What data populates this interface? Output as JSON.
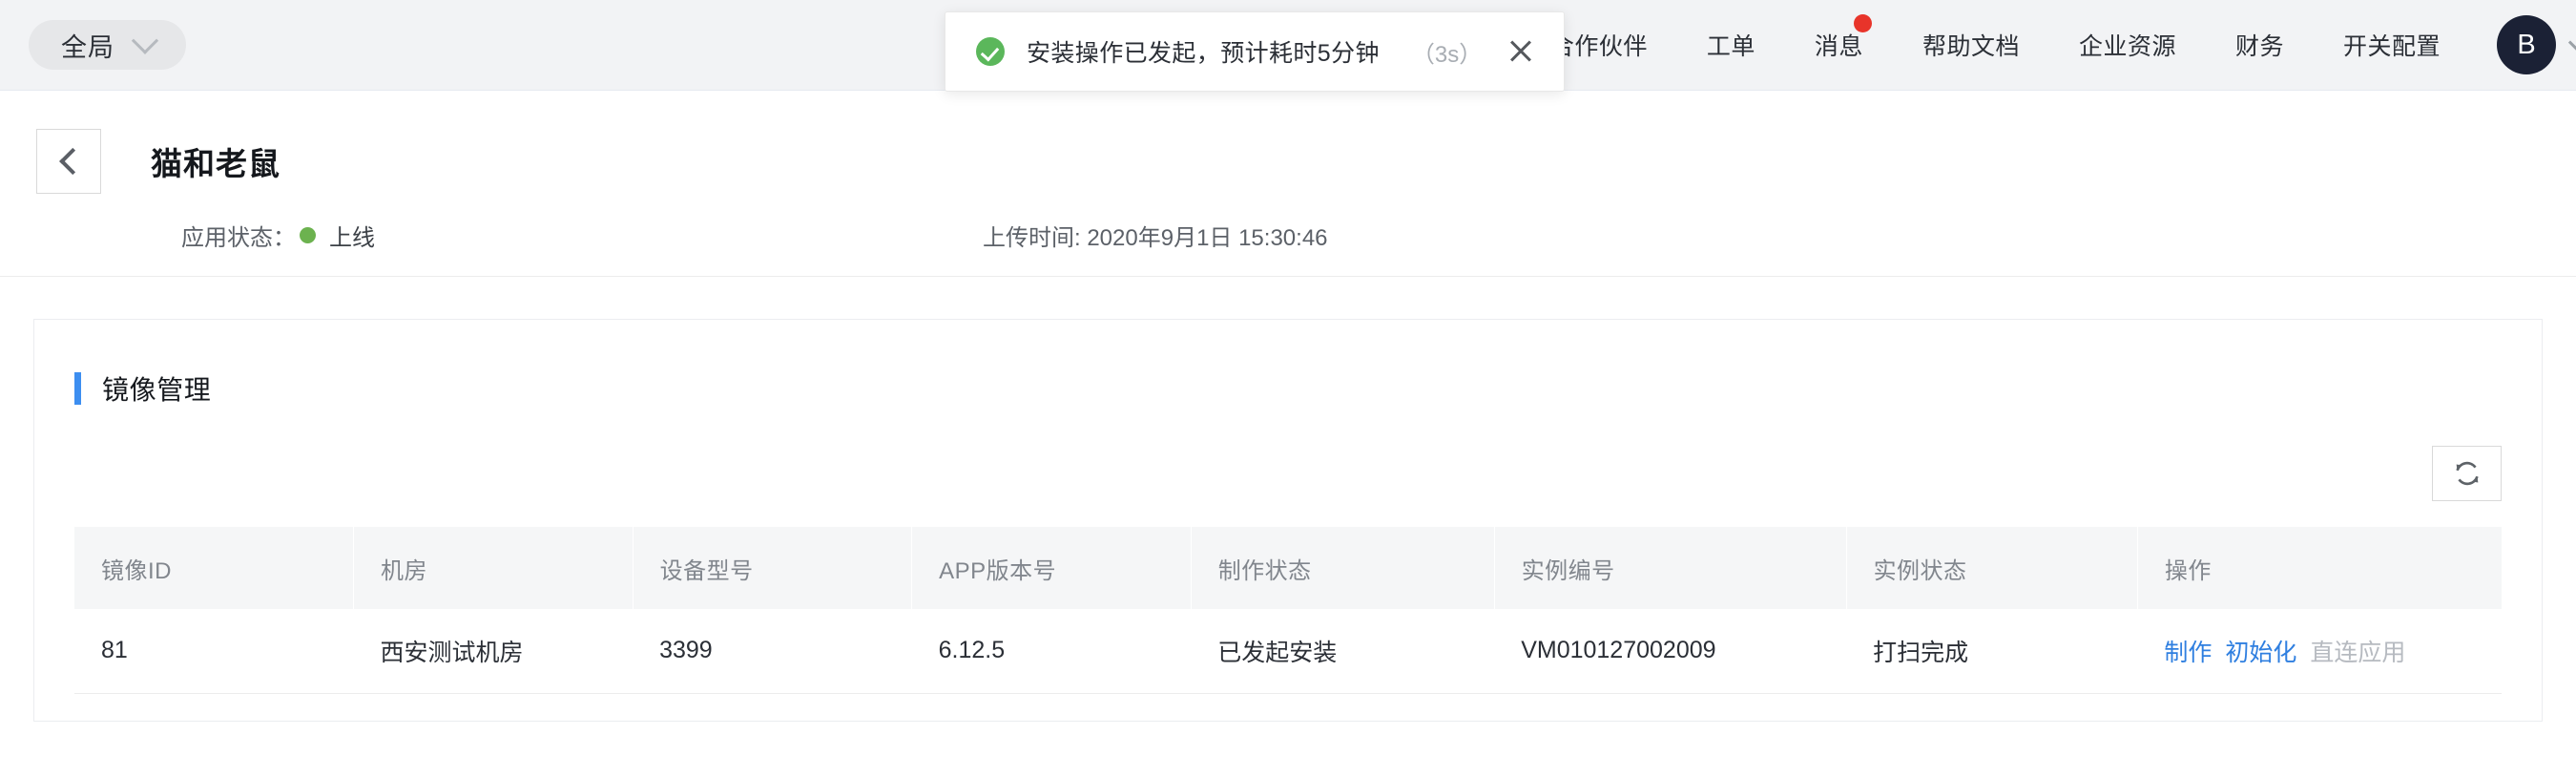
{
  "topbar": {
    "scope_selector": {
      "label": "全局",
      "icon": "chevron-down-icon"
    },
    "nav_items": [
      {
        "label": "合作伙伴",
        "badge": false
      },
      {
        "label": "工单",
        "badge": false
      },
      {
        "label": "消息",
        "badge": true
      },
      {
        "label": "帮助文档",
        "badge": false
      },
      {
        "label": "企业资源",
        "badge": false
      },
      {
        "label": "财务",
        "badge": false
      },
      {
        "label": "开关配置",
        "badge": false
      }
    ],
    "avatar": {
      "initial": "B",
      "bg_color": "#1b2135"
    },
    "badge_color": "#e8342a"
  },
  "toast": {
    "icon": "success-check-icon",
    "icon_color": "#5bb75b",
    "message": "安装操作已发起，预计耗时5分钟",
    "countdown": "（3s）",
    "close_icon": "close-icon"
  },
  "page_header": {
    "back_icon": "chevron-left-icon",
    "title": "猫和老鼠",
    "status_label": "应用状态：",
    "status_value": "上线",
    "status_color": "#6cb24f",
    "upload_time": "上传时间: 2020年9月1日 15:30:46"
  },
  "card": {
    "title": "镜像管理",
    "accent_color": "#3d8ef0",
    "refresh_icon": "refresh-icon"
  },
  "table": {
    "columns": [
      "镜像ID",
      "机房",
      "设备型号",
      "APP版本号",
      "制作状态",
      "实例编号",
      "实例状态",
      "操作"
    ],
    "rows": [
      {
        "image_id": "81",
        "data_center": "西安测试机房",
        "device_model": "3399",
        "app_version": "6.12.5",
        "build_status": "已发起安装",
        "instance_no": "VM010127002009",
        "instance_status": "打扫完成",
        "actions": [
          {
            "label": "制作",
            "enabled": true
          },
          {
            "label": "初始化",
            "enabled": true
          },
          {
            "label": "直连应用",
            "enabled": false
          }
        ]
      }
    ],
    "link_color": "#2f7fe0",
    "disabled_color": "#b6bac0"
  }
}
